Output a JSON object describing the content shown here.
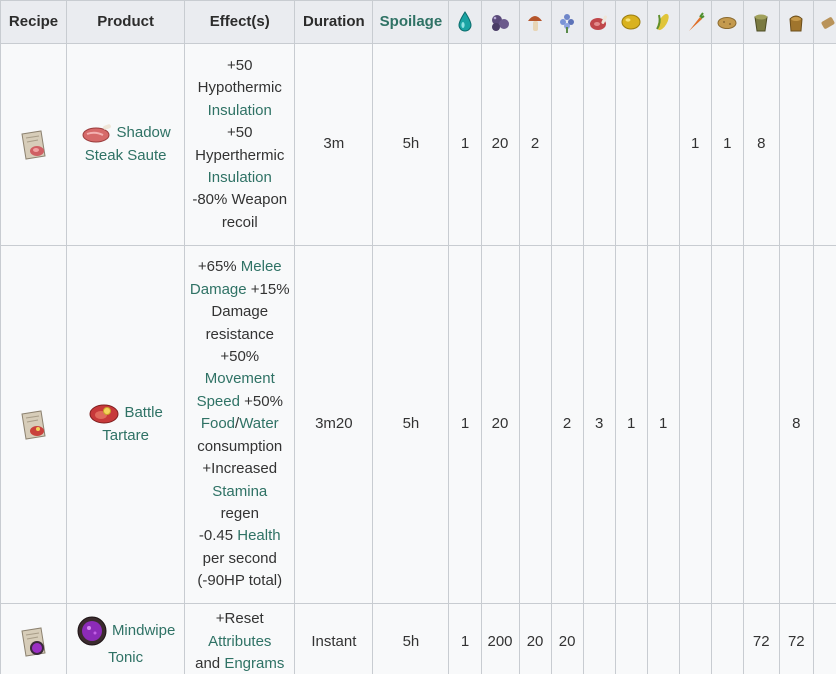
{
  "headers": {
    "recipe": "Recipe",
    "product": "Product",
    "effects": "Effect(s)",
    "duration": "Duration",
    "spoilage": "Spoilage",
    "icons": [
      "water-drop-icon",
      "berries-icon",
      "mushroom-icon",
      "flower-icon",
      "raw-meat-icon",
      "lemon-icon",
      "corn-icon",
      "carrot-icon",
      "potato-icon",
      "fertilizer-icon",
      "seed-bag-icon",
      "tool-icon"
    ]
  },
  "rows": [
    {
      "product_line1": "Shadow",
      "product_line2": "Steak Saute",
      "effects": [
        {
          "text": "+50",
          "link": false
        },
        {
          "text": "Hypothermic",
          "link": false
        },
        {
          "text": "Insulation",
          "link": true
        },
        {
          "text": "+50",
          "link": false
        },
        {
          "text": "Hyperthermic",
          "link": false
        },
        {
          "text": "Insulation",
          "link": true
        },
        {
          "text": "-80% Weapon",
          "link": false
        },
        {
          "text": "recoil",
          "link": false
        }
      ],
      "duration": "3m",
      "spoilage": "5h",
      "amounts": [
        "1",
        "20",
        "2",
        "",
        "",
        "",
        "",
        "1",
        "1",
        "8",
        "",
        ""
      ]
    },
    {
      "product_line1": "Battle",
      "product_line2": "Tartare",
      "effects_lines": [
        [
          {
            "text": "+65% ",
            "link": false
          },
          {
            "text": "Melee",
            "link": true
          }
        ],
        [
          {
            "text": "Damage",
            "link": true
          },
          {
            "text": " +15%",
            "link": false
          }
        ],
        [
          {
            "text": "Damage",
            "link": false
          }
        ],
        [
          {
            "text": "resistance",
            "link": false
          }
        ],
        [
          {
            "text": "+50%",
            "link": false
          }
        ],
        [
          {
            "text": "Movement",
            "link": true
          }
        ],
        [
          {
            "text": "Speed",
            "link": true
          },
          {
            "text": " +50%",
            "link": false
          }
        ],
        [
          {
            "text": "Food",
            "link": true
          },
          {
            "text": "/",
            "link": false
          },
          {
            "text": "Water",
            "link": true
          }
        ],
        [
          {
            "text": "consumption",
            "link": false
          }
        ],
        [
          {
            "text": "+Increased",
            "link": false
          }
        ],
        [
          {
            "text": "Stamina",
            "link": true
          }
        ],
        [
          {
            "text": "regen",
            "link": false
          }
        ],
        [
          {
            "text": "-0.45 ",
            "link": false
          },
          {
            "text": "Health",
            "link": true
          }
        ],
        [
          {
            "text": "per second",
            "link": false
          }
        ],
        [
          {
            "text": "(-90HP total)",
            "link": false
          }
        ]
      ],
      "duration": "3m20",
      "spoilage": "5h",
      "amounts": [
        "1",
        "20",
        "",
        "2",
        "3",
        "1",
        "1",
        "",
        "",
        "",
        "8",
        ""
      ]
    },
    {
      "product_line1": "Mindwipe",
      "product_line2": "Tonic",
      "effects_lines": [
        [
          {
            "text": "+Reset",
            "link": false
          }
        ],
        [
          {
            "text": "Attributes",
            "link": true
          }
        ],
        [
          {
            "text": "and ",
            "link": false
          },
          {
            "text": "Engrams",
            "link": true
          }
        ]
      ],
      "duration": "Instant",
      "spoilage": "5h",
      "amounts": [
        "1",
        "200",
        "20",
        "20",
        "",
        "",
        "",
        "",
        "",
        "72",
        "72",
        ""
      ]
    }
  ],
  "colors": {
    "link": "#2f7265",
    "header_bg": "#eaecf0",
    "border": "#c8ccd1",
    "body_bg": "#f8f9fa"
  }
}
